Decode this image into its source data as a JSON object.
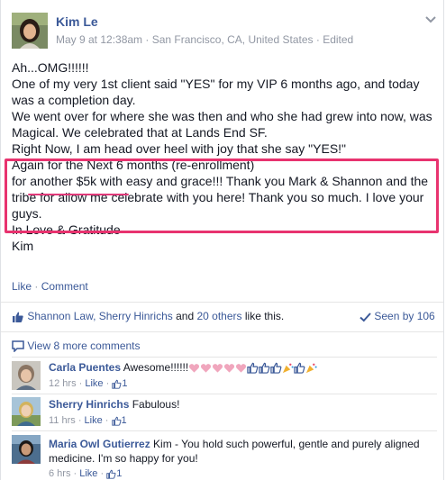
{
  "post": {
    "author": "Kim Le",
    "timestamp": "May 9 at 12:38am",
    "location": "San Francisco, CA, United States",
    "edited": "Edited",
    "sep": "·",
    "lines": [
      "Ah...OMG!!!!!!",
      "One of my very 1st client said \"YES\" for my VIP 6 months ago, and today was a completion day.",
      "We went over for where she was then and who she had grew into now, was Magical. We celebrated that at Lands End SF.",
      "Right Now, I am head over heel with joy that she say \"YES!\"",
      "Again for the Next 6 months (re-enrollment)",
      "for another $5k with easy and grace!!! Thank you Mark & Shannon and the tribe for allow me celebrate with you here! Thank you so much. I love your guys.",
      "In Love & Gratitude",
      "Kim"
    ],
    "like_label": "Like",
    "comment_label": "Comment",
    "action_sep": "·"
  },
  "likes": {
    "names": "Shannon Law, Sherry Hinrichs",
    "and": "and",
    "others": "20 others",
    "suffix": "like this.",
    "seen": "Seen by 106"
  },
  "view_more": "View 8 more comments",
  "comments": [
    {
      "name": "Carla Puentes",
      "text": "Awesome!!!!!!",
      "time": "12 hrs",
      "like": "Like",
      "count": "1"
    },
    {
      "name": "Sherry Hinrichs",
      "text": "Fabulous!",
      "time": "11 hrs",
      "like": "Like",
      "count": "1"
    },
    {
      "name": "Maria Owl Gutierrez",
      "text": "Kim - You hold such powerful, gentle and purely aligned",
      "text2": "medicine. I'm so happy for you!",
      "time": "6 hrs",
      "like": "Like",
      "count": "1"
    }
  ],
  "colors": {
    "link": "#3b5998",
    "meta": "#9197a3",
    "highlight": "#e8336f",
    "heart": "#f0a6bd"
  },
  "icons": [
    "chevron-down-icon",
    "thumbs-up-icon",
    "check-icon",
    "comment-bubble-icon",
    "heart-icon",
    "party-popper-icon"
  ]
}
